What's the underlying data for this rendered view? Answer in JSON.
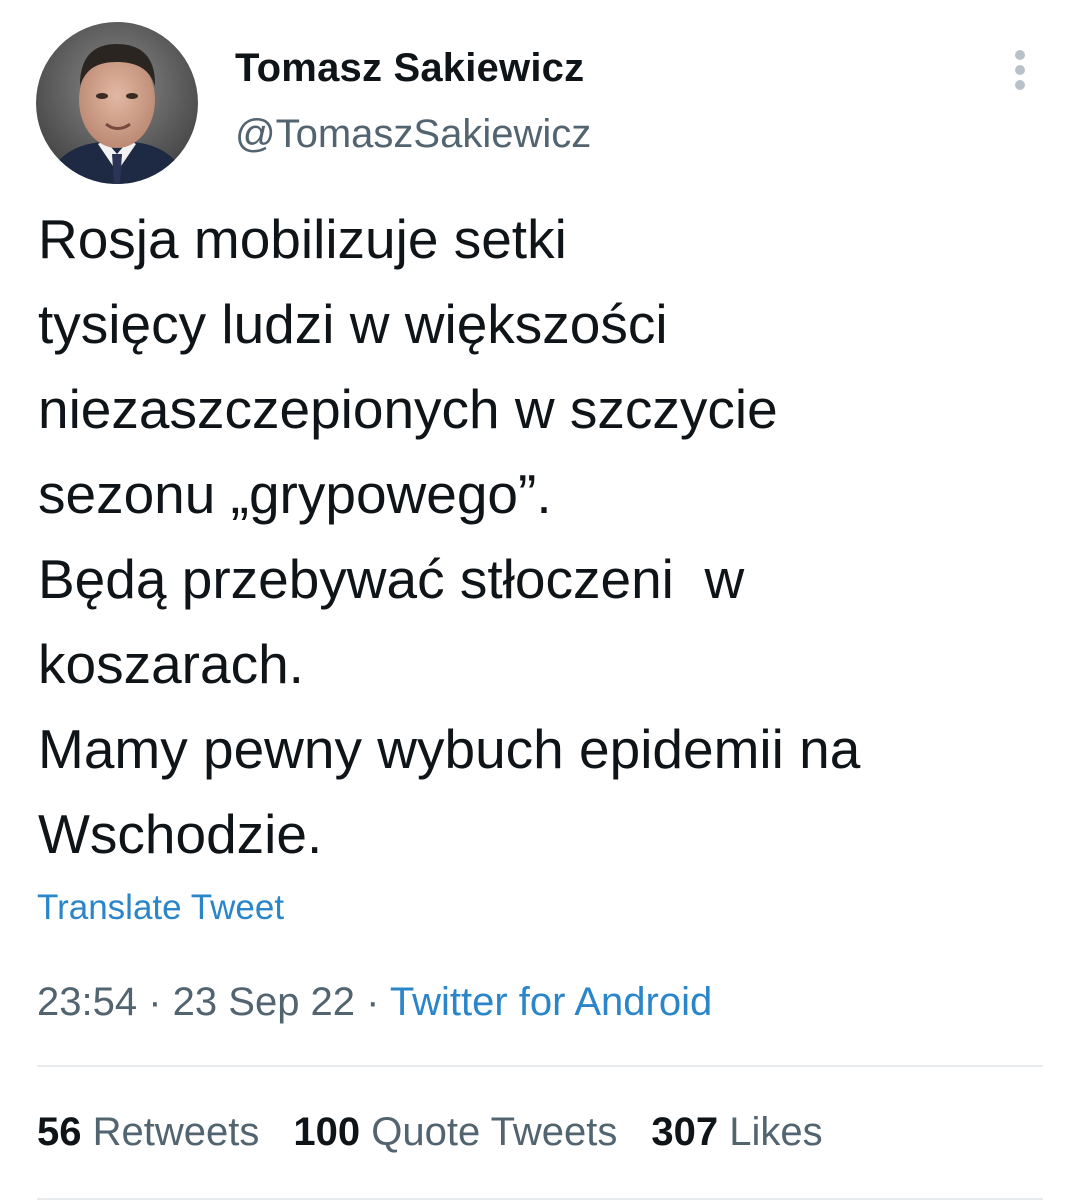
{
  "author": {
    "display_name": "Tomasz Sakiewicz",
    "handle": "@TomaszSakiewicz"
  },
  "tweet": {
    "lines": [
      "Rosja mobilizuje setki",
      "tysięcy ludzi w większości",
      "niezaszczepionych w szczycie",
      "sezonu „grypowego”.",
      "Będą przebywać stłoczeni  w",
      "koszarach.",
      "Mamy pewny wybuch epidemii na",
      "Wschodzie."
    ],
    "translate_label": "Translate Tweet"
  },
  "meta": {
    "time": "23:54",
    "separator": " · ",
    "date": "23 Sep 22",
    "source": "Twitter for Android"
  },
  "stats": {
    "retweets_count": "56",
    "retweets_label": "Retweets",
    "quotes_count": "100",
    "quotes_label": "Quote Tweets",
    "likes_count": "307",
    "likes_label": "Likes"
  },
  "icons": {
    "more": "more-vertical-icon"
  },
  "colors": {
    "link": "#2a86c9",
    "secondary_text": "#536471",
    "primary_text": "#0f1419",
    "divider": "#e7ebee"
  }
}
